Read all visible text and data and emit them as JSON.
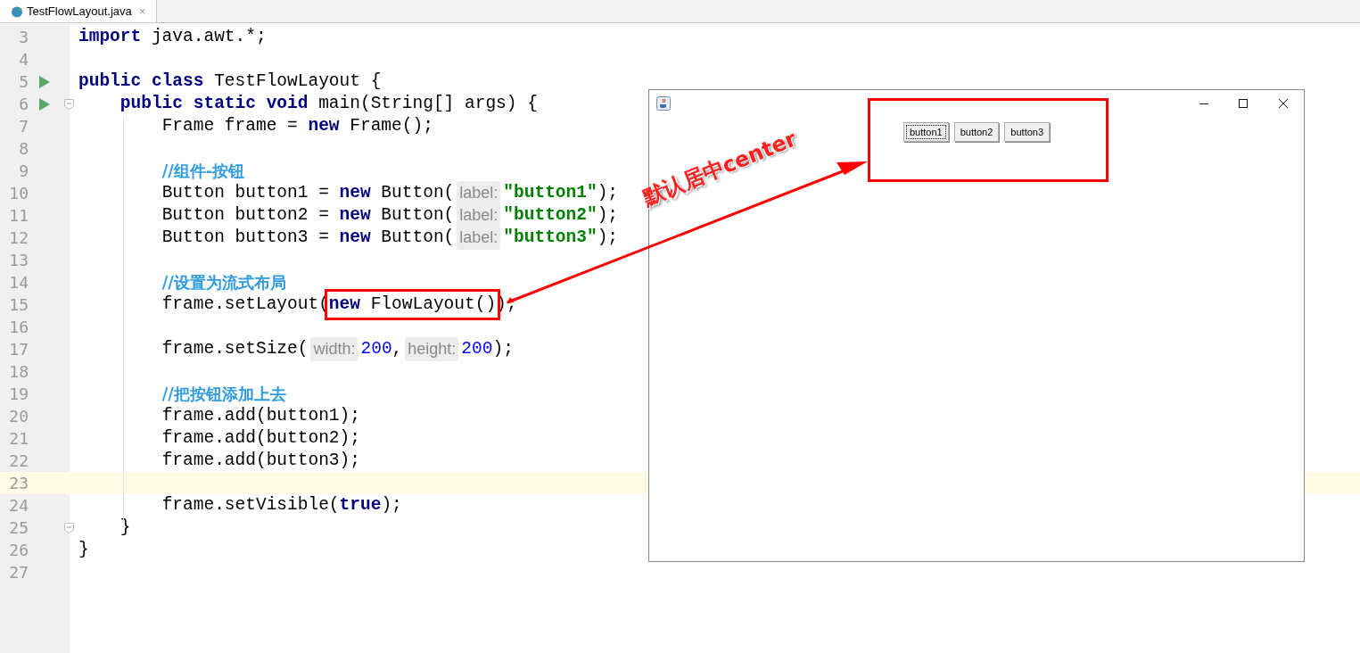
{
  "tab": {
    "title": "TestFlowLayout.java",
    "close": "×",
    "selected": true
  },
  "lines": [
    {
      "number": "3",
      "tokens": [
        {
          "kind": "keyword",
          "text": "import"
        },
        {
          "kind": "plain",
          "text": " java.awt.*;"
        }
      ]
    },
    {
      "number": "4"
    },
    {
      "number": "5",
      "run": true,
      "tokens": [
        {
          "kind": "keyword",
          "text": "public class"
        },
        {
          "kind": "plain",
          "text": " TestFlowLayout {"
        }
      ]
    },
    {
      "number": "6",
      "run": true,
      "fold": true,
      "tokens": [
        {
          "kind": "keyword",
          "text": "    public static void"
        },
        {
          "kind": "plain",
          "text": " main(String[] args) {"
        }
      ]
    },
    {
      "number": "7",
      "tokens": [
        {
          "kind": "plain",
          "text": "        Frame frame = "
        },
        {
          "kind": "keyword",
          "text": "new"
        },
        {
          "kind": "plain",
          "text": " Frame();"
        }
      ]
    },
    {
      "number": "8"
    },
    {
      "number": "9",
      "tokens": [
        {
          "kind": "comment",
          "text": "        //组件-按钮"
        }
      ]
    },
    {
      "number": "10",
      "tokens": [
        {
          "kind": "plain",
          "text": "        Button button1 = "
        },
        {
          "kind": "keyword",
          "text": "new"
        },
        {
          "kind": "plain",
          "text": " Button("
        },
        {
          "kind": "hint",
          "text": "label:"
        },
        {
          "kind": "string",
          "text": "\"button1\""
        },
        {
          "kind": "plain",
          "text": ");"
        }
      ]
    },
    {
      "number": "11",
      "tokens": [
        {
          "kind": "plain",
          "text": "        Button button2 = "
        },
        {
          "kind": "keyword",
          "text": "new"
        },
        {
          "kind": "plain",
          "text": " Button("
        },
        {
          "kind": "hint",
          "text": "label:"
        },
        {
          "kind": "string",
          "text": "\"button2\""
        },
        {
          "kind": "plain",
          "text": ");"
        }
      ]
    },
    {
      "number": "12",
      "tokens": [
        {
          "kind": "plain",
          "text": "        Button button3 = "
        },
        {
          "kind": "keyword",
          "text": "new"
        },
        {
          "kind": "plain",
          "text": " Button("
        },
        {
          "kind": "hint",
          "text": "label:"
        },
        {
          "kind": "string",
          "text": "\"button3\""
        },
        {
          "kind": "plain",
          "text": ");"
        }
      ]
    },
    {
      "number": "13"
    },
    {
      "number": "14",
      "tokens": [
        {
          "kind": "comment",
          "text": "        //设置为流式布局"
        }
      ]
    },
    {
      "number": "15",
      "tokens": [
        {
          "kind": "plain",
          "text": "        frame.setLayout("
        },
        {
          "kind": "keyword",
          "text": "new",
          "boxed": true
        },
        {
          "kind": "plain",
          "text": " FlowLayout()",
          "boxed": true
        },
        {
          "kind": "plain",
          "text": ");"
        }
      ]
    },
    {
      "number": "16"
    },
    {
      "number": "17",
      "tokens": [
        {
          "kind": "plain",
          "text": "        frame.setSize("
        },
        {
          "kind": "hint",
          "text": "width:"
        },
        {
          "kind": "number",
          "text": "200"
        },
        {
          "kind": "plain",
          "text": ","
        },
        {
          "kind": "hint",
          "text": "height:"
        },
        {
          "kind": "number",
          "text": "200"
        },
        {
          "kind": "plain",
          "text": ");"
        }
      ]
    },
    {
      "number": "18"
    },
    {
      "number": "19",
      "tokens": [
        {
          "kind": "comment",
          "text": "        //把按钮添加上去"
        }
      ]
    },
    {
      "number": "20",
      "tokens": [
        {
          "kind": "plain",
          "text": "        frame.add(button1);"
        }
      ]
    },
    {
      "number": "21",
      "tokens": [
        {
          "kind": "plain",
          "text": "        frame.add(button2);"
        }
      ]
    },
    {
      "number": "22",
      "tokens": [
        {
          "kind": "plain",
          "text": "        frame.add(button3);"
        }
      ]
    },
    {
      "number": "23",
      "current": true
    },
    {
      "number": "24",
      "tokens": [
        {
          "kind": "plain",
          "text": "        frame.setVisible("
        },
        {
          "kind": "keyword",
          "text": "true"
        },
        {
          "kind": "plain",
          "text": ");"
        }
      ]
    },
    {
      "number": "25",
      "fold": true,
      "tokens": [
        {
          "kind": "plain",
          "text": "    }"
        }
      ]
    },
    {
      "number": "26",
      "tokens": [
        {
          "kind": "plain",
          "text": "}"
        }
      ]
    },
    {
      "number": "27"
    }
  ],
  "java_window": {
    "buttons": [
      {
        "label": "button1",
        "focused": true
      },
      {
        "label": "button2",
        "focused": false
      },
      {
        "label": "button3",
        "focused": false
      }
    ]
  },
  "annotation": {
    "text": "默认居中center"
  }
}
